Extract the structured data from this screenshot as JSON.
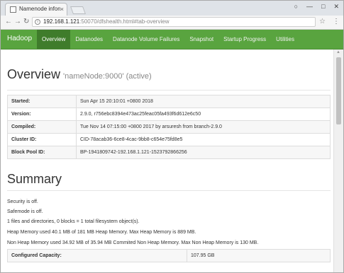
{
  "browser": {
    "tab_title": "Namenode informatio",
    "tab_close": "×",
    "window_controls": [
      "○",
      "—",
      "□",
      "✕"
    ],
    "url_host": "192.168.1.121",
    "url_rest": ":50070/dfshealth.html#tab-overview",
    "info_glyph": "i",
    "nav_icons": [
      "back-icon",
      "forward-icon",
      "reload-icon",
      "star-icon",
      "menu-icon"
    ]
  },
  "navbar": {
    "brand": "Hadoop",
    "items": [
      {
        "label": "Overview",
        "active": true
      },
      {
        "label": "Datanodes",
        "active": false
      },
      {
        "label": "Datanode Volume Failures",
        "active": false
      },
      {
        "label": "Snapshot",
        "active": false
      },
      {
        "label": "Startup Progress",
        "active": false
      },
      {
        "label": "Utilities",
        "active": false
      }
    ],
    "accent": "#59a43f"
  },
  "overview": {
    "title": "Overview",
    "subtitle": "'nameNode:9000' (active)",
    "rows": [
      {
        "key": "Started:",
        "value": "Sun Apr 15 20:10:01 +0800 2018"
      },
      {
        "key": "Version:",
        "value": "2.9.0, r756ebc8394e473ac25feac05fa493f6d612e6c50"
      },
      {
        "key": "Compiled:",
        "value": "Tue Nov 14 07:15:00 +0800 2017 by arsuresh from branch-2.9.0"
      },
      {
        "key": "Cluster ID:",
        "value": "CID-78acab36-6ce8-4cac-9bb8-c654e75fd8e5"
      },
      {
        "key": "Block Pool ID:",
        "value": "BP-1941809742-192.168.1.121-1523792866256"
      }
    ]
  },
  "summary": {
    "title": "Summary",
    "lines": [
      "Security is off.",
      "Safemode is off.",
      "1 files and directories, 0 blocks = 1 total filesystem object(s).",
      "Heap Memory used 40.1 MB of 181 MB Heap Memory. Max Heap Memory is 889 MB.",
      "Non Heap Memory used 34.92 MB of 35.94 MB Commited Non Heap Memory. Max Non Heap Memory is 130 MB."
    ],
    "capacity": {
      "key": "Configured Capacity:",
      "value": "107.95 GB"
    }
  }
}
